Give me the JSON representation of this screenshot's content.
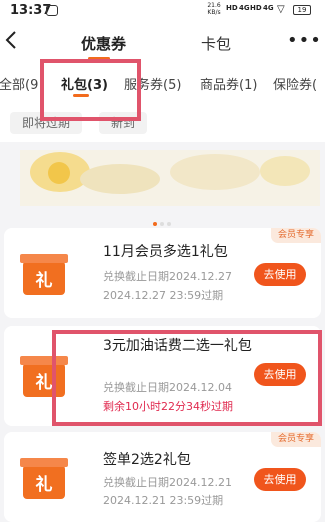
{
  "status_bar": {
    "time": "13:37",
    "speed_value": "21.6",
    "speed_unit": "KB/s",
    "signal_1": "HD",
    "signal_2": "4G",
    "signal_3": "HD",
    "signal_4": "4G",
    "battery": "19"
  },
  "header": {
    "back_icon": "back-arrow-icon",
    "tabs": [
      {
        "label": "优惠券",
        "active": true
      },
      {
        "label": "卡包",
        "active": false
      }
    ],
    "more_icon": "more-icon"
  },
  "subtabs": [
    {
      "label": "全部(9",
      "active": false
    },
    {
      "label": "礼包(3)",
      "active": true
    },
    {
      "label": "服务券(5)",
      "active": false
    },
    {
      "label": "商品券(1)",
      "active": false
    },
    {
      "label": "保险券(",
      "active": false
    }
  ],
  "filters": [
    {
      "label": "即将过期"
    },
    {
      "label": "新到"
    }
  ],
  "coupons": [
    {
      "icon_char": "礼",
      "title": "11月会员多选1礼包",
      "deadline": "兑换截止日期2024.12.27",
      "expiry": "2024.12.27 23:59过期",
      "button": "去使用",
      "tag": "会员专享"
    },
    {
      "icon_char": "礼",
      "title": "3元加油话费二选一礼包",
      "deadline": "兑换截止日期2024.12.04",
      "expiry": "剩余10小时22分34秒过期",
      "button": "去使用",
      "tag": ""
    },
    {
      "icon_char": "礼",
      "title": "签单2选2礼包",
      "deadline": "兑换截止日期2024.12.21",
      "expiry": "2024.12.21 23:59过期",
      "button": "去使用",
      "tag": "会员专享"
    }
  ],
  "colors": {
    "accent": "#f26b1d",
    "button": "#f0551c",
    "highlight": "#e0546b",
    "countdown": "#e02a4f"
  }
}
